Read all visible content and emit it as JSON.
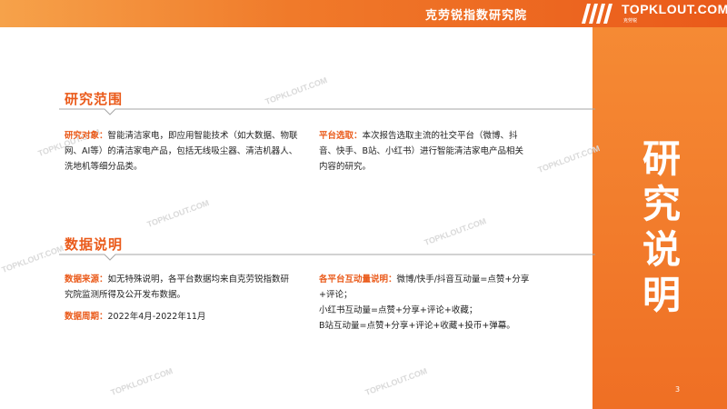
{
  "header": {
    "org_name": "克劳锐指数研究院",
    "brand": "TOPKLOUT.COM",
    "brand_subtitle": "克劳锐"
  },
  "side": {
    "title_chars": [
      "研",
      "究",
      "说",
      "明"
    ],
    "page_number": "3"
  },
  "watermark_text": "TOPKLOUT.COM",
  "section_scope": {
    "title": "研究范围",
    "object_label": "研究对象：",
    "object_text": "智能清洁家电，即应用智能技术（如大数据、物联网、AI等）的清洁家电产品，包括无线吸尘器、清洁机器人、洗地机等细分品类。",
    "platform_label": "平台选取：",
    "platform_text": "本次报告选取主流的社交平台（微博、抖音、快手、B站、小红书）进行智能清洁家电产品相关内容的研究。"
  },
  "section_data": {
    "title": "数据说明",
    "source_label": "数据来源：",
    "source_text": "如无特殊说明，各平台数据均来自克劳锐指数研究院监测所得及公开发布数据。",
    "period_label": "数据周期：",
    "period_text": "2022年4月-2022年11月",
    "interaction_label": "各平台互动量说明：",
    "interaction_line1": "微博/快手/抖音互动量=点赞+分享+评论；",
    "interaction_line2": "小红书互动量=点赞+分享+评论+收藏；",
    "interaction_line3": "B站互动量=点赞+分享+评论+收藏+投币+弹幕。"
  },
  "colors": {
    "accent": "#ea5a1a",
    "panel": "#f07a2a"
  }
}
